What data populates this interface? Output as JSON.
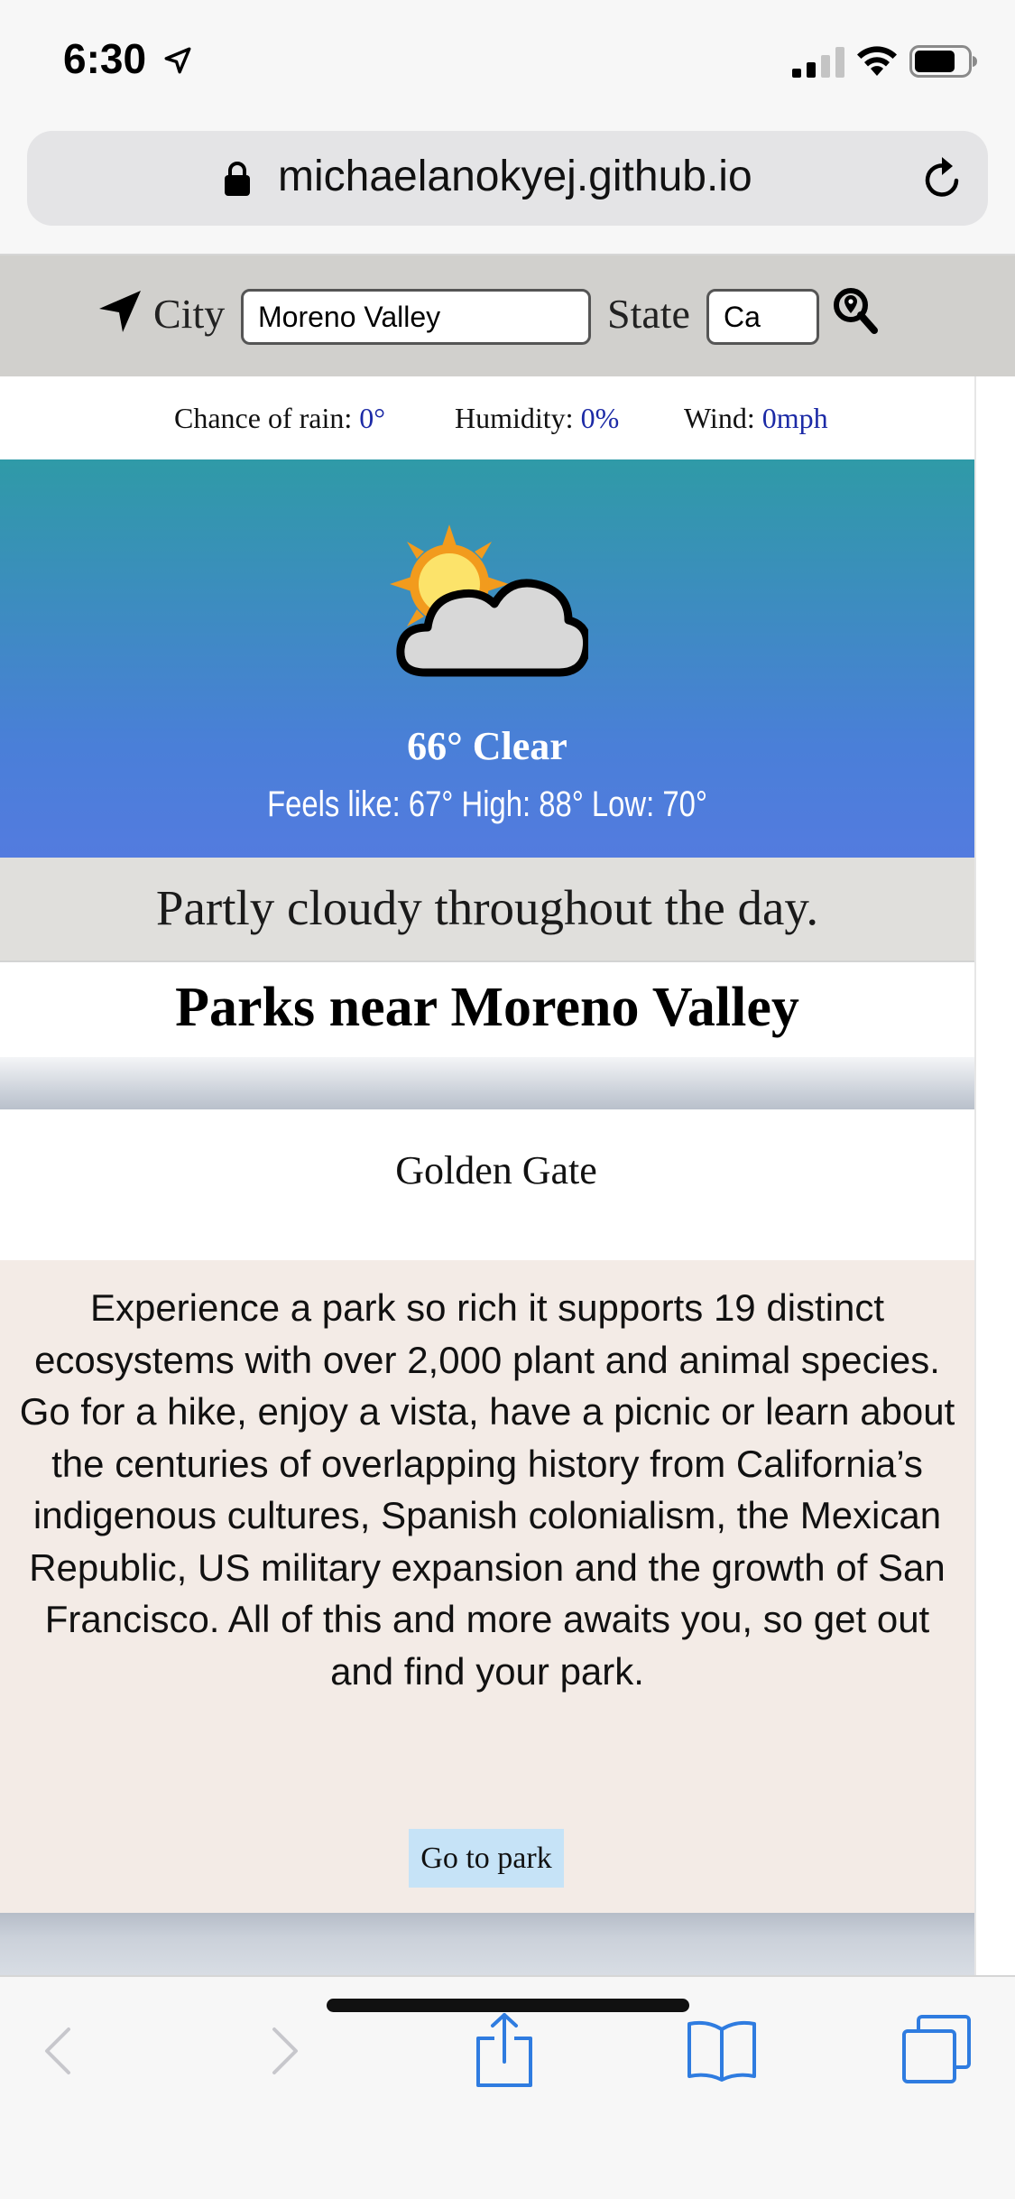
{
  "status_bar": {
    "time": "6:30"
  },
  "browser": {
    "url": "michaelanokyej.github.io"
  },
  "search": {
    "city_label": "City",
    "city_value": "Moreno Valley",
    "state_label": "State",
    "state_value": "Ca"
  },
  "stats": {
    "rain_label": "Chance of rain: ",
    "rain_value": "0°",
    "humidity_label": "Humidity: ",
    "humidity_value": "0%",
    "wind_label": "Wind: ",
    "wind_value": "0mph"
  },
  "weather": {
    "icon": "partly-cloudy-icon",
    "temp_summary": "66° Clear",
    "feels_line": "Feels like: 67° High: 88° Low: 70°",
    "day_summary": "Partly cloudy throughout the day."
  },
  "parks": {
    "heading": "Parks near Moreno Valley",
    "items": [
      {
        "name": "Golden Gate",
        "description": "Experience a park so rich it supports 19 distinct ecosystems with over 2,000 plant and animal species. Go for a hike, enjoy a vista, have a picnic or learn about the centuries of overlapping history from California’s indigenous cultures, Spanish colonialism, the Mexican Republic, US military expansion and the growth of San Francisco. All of this and more awaits you, so get out and find your park.",
        "button_label": "Go to park"
      }
    ]
  },
  "colors": {
    "accent_link": "#1c2aa6",
    "weather_gradient_top": "#2f9aa7",
    "weather_gradient_bottom": "#537bdf",
    "button_bg": "#c6e3f7",
    "safari_blue": "#2f7ce0"
  }
}
